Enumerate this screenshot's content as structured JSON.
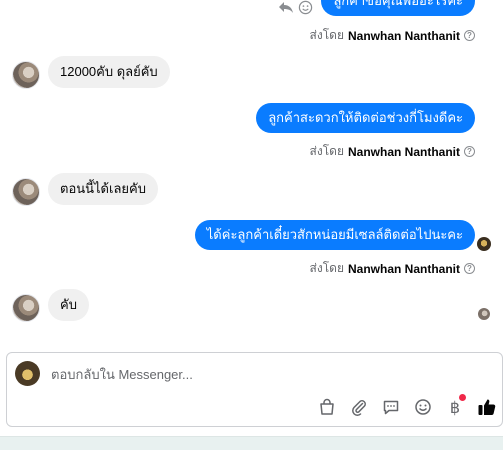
{
  "messages": [
    {
      "direction": "out",
      "text": "ลูกค้าขอคุณพ่ออะไรคะ"
    },
    {
      "direction": "out_meta",
      "sent_by_prefix": "ส่งโดย",
      "sent_by_name": "Nanwhan Nanthanit"
    },
    {
      "direction": "in",
      "text": "12000คับ ดุลย์คับ"
    },
    {
      "direction": "out",
      "text": "ลูกค้าสะดวกให้ติดต่อช่วงกี่โมงดีคะ"
    },
    {
      "direction": "out_meta",
      "sent_by_prefix": "ส่งโดย",
      "sent_by_name": "Nanwhan Nanthanit"
    },
    {
      "direction": "in",
      "text": "ตอนนี้ได้เลยคับ"
    },
    {
      "direction": "out",
      "text": "ได้ค่ะลูกค้าเดี๋ยวสักหน่อยมีเซลล์ติดต่อไปนะคะ"
    },
    {
      "direction": "out_meta",
      "sent_by_prefix": "ส่งโดย",
      "sent_by_name": "Nanwhan Nanthanit"
    },
    {
      "direction": "in",
      "text": "คับ"
    }
  ],
  "composer": {
    "placeholder": "ตอบกลับใน Messenger..."
  },
  "icons": {
    "help": "?",
    "baht": "฿"
  },
  "colors": {
    "outgoing_bubble": "#0a7cff",
    "incoming_bubble": "#f0f0f0",
    "like": "#050505",
    "notification_dot": "#f02849"
  }
}
